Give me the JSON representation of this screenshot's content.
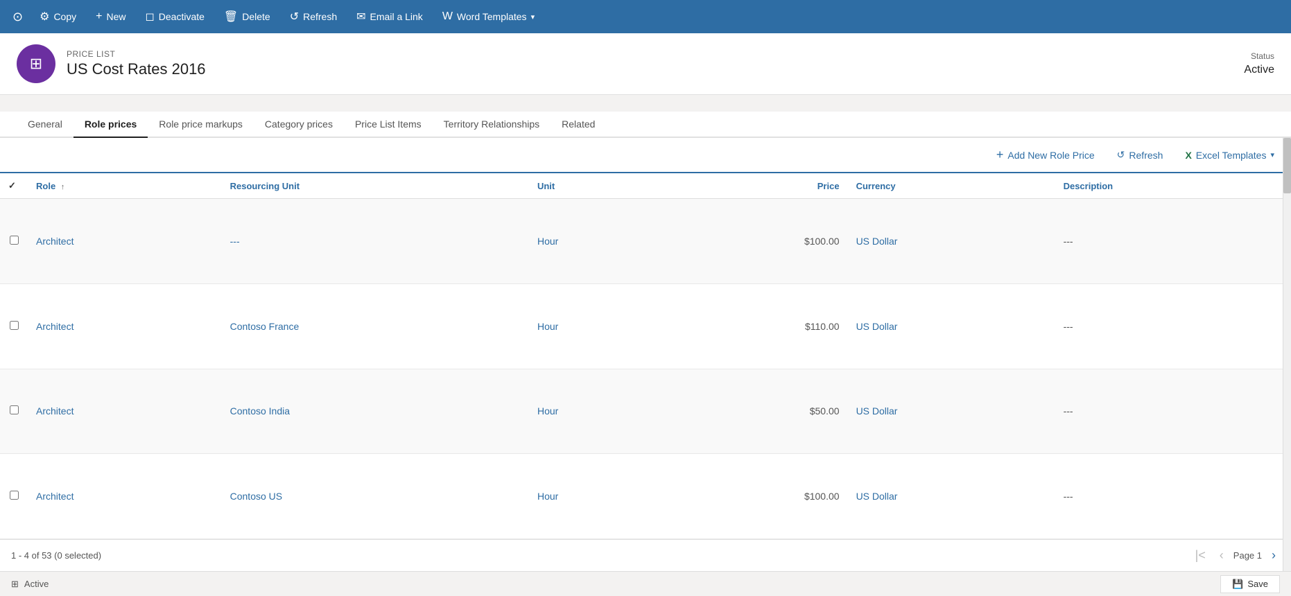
{
  "toolbar": {
    "history_icon": "⊙",
    "settings_icon": "⚙",
    "copy_label": "Copy",
    "new_label": "New",
    "deactivate_label": "Deactivate",
    "delete_label": "Delete",
    "refresh_label": "Refresh",
    "email_label": "Email a Link",
    "word_templates_label": "Word Templates"
  },
  "header": {
    "record_type": "PRICE LIST",
    "title": "US Cost Rates 2016",
    "avatar_icon": "⊞",
    "status_label": "Status",
    "status_value": "Active"
  },
  "tabs": [
    {
      "id": "general",
      "label": "General",
      "active": false
    },
    {
      "id": "role-prices",
      "label": "Role prices",
      "active": true
    },
    {
      "id": "role-price-markups",
      "label": "Role price markups",
      "active": false
    },
    {
      "id": "category-prices",
      "label": "Category prices",
      "active": false
    },
    {
      "id": "price-list-items",
      "label": "Price List Items",
      "active": false
    },
    {
      "id": "territory-relationships",
      "label": "Territory Relationships",
      "active": false
    },
    {
      "id": "related",
      "label": "Related",
      "active": false
    }
  ],
  "grid": {
    "add_new_label": "Add New Role Price",
    "refresh_label": "Refresh",
    "excel_templates_label": "Excel Templates",
    "columns": [
      {
        "id": "role",
        "label": "Role",
        "sortable": true
      },
      {
        "id": "resourcing-unit",
        "label": "Resourcing Unit",
        "sortable": false
      },
      {
        "id": "unit",
        "label": "Unit",
        "sortable": false
      },
      {
        "id": "price",
        "label": "Price",
        "sortable": false
      },
      {
        "id": "currency",
        "label": "Currency",
        "sortable": false
      },
      {
        "id": "description",
        "label": "Description",
        "sortable": false
      }
    ],
    "rows": [
      {
        "role": "Architect",
        "resourcing_unit": "---",
        "unit": "Hour",
        "price": "$100.00",
        "currency": "US Dollar",
        "description": "---"
      },
      {
        "role": "Architect",
        "resourcing_unit": "Contoso France",
        "unit": "Hour",
        "price": "$110.00",
        "currency": "US Dollar",
        "description": "---"
      },
      {
        "role": "Architect",
        "resourcing_unit": "Contoso India",
        "unit": "Hour",
        "price": "$50.00",
        "currency": "US Dollar",
        "description": "---"
      },
      {
        "role": "Architect",
        "resourcing_unit": "Contoso US",
        "unit": "Hour",
        "price": "$100.00",
        "currency": "US Dollar",
        "description": "---"
      }
    ],
    "pagination": {
      "summary": "1 - 4 of 53 (0 selected)",
      "page_label": "Page 1"
    }
  },
  "status_bar": {
    "status_icon": "⊞",
    "status_text": "Active",
    "save_icon": "💾",
    "save_label": "Save"
  }
}
